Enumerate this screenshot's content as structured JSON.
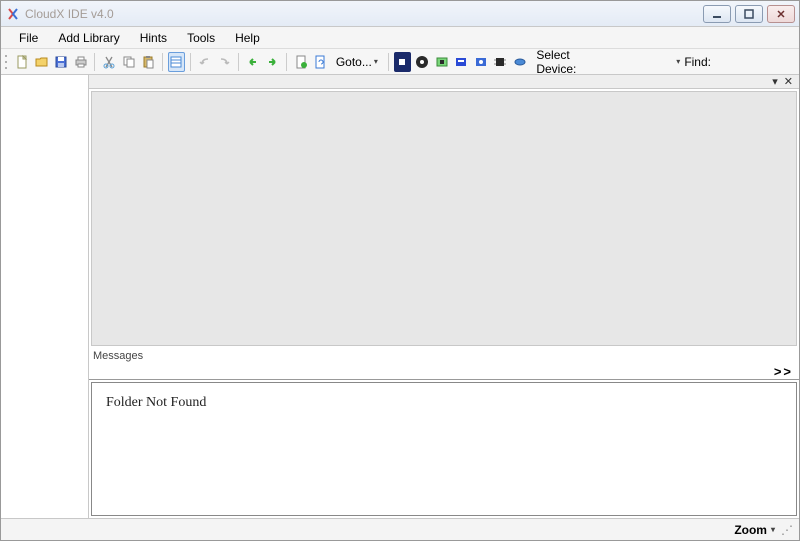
{
  "window": {
    "title": "CloudX IDE v4.0"
  },
  "menu": {
    "file": "File",
    "add_library": "Add Library",
    "hints": "Hints",
    "tools": "Tools",
    "help": "Help"
  },
  "toolbar": {
    "goto_label": "Goto...",
    "select_device_label": "Select Device:",
    "find_label": "Find:",
    "find_value": ""
  },
  "panels": {
    "messages_label": "Messages",
    "messages_collapse": ">>"
  },
  "messages": {
    "text": "Folder Not Found"
  },
  "statusbar": {
    "zoom_label": "Zoom"
  }
}
